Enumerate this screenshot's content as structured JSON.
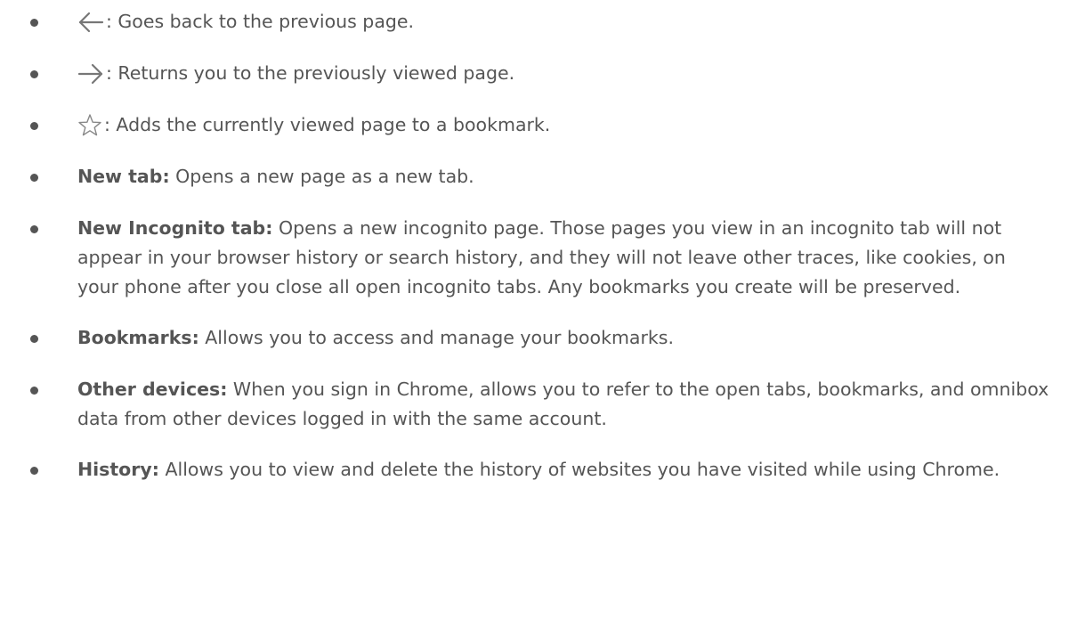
{
  "items": [
    {
      "icon": "back-arrow-icon",
      "desc": ": Goes back to the previous page."
    },
    {
      "icon": "forward-arrow-icon",
      "desc": ": Returns you to the previously viewed page."
    },
    {
      "icon": "star-outline-icon",
      "desc": ": Adds the currently viewed page to a bookmark."
    },
    {
      "term": "New tab:",
      "desc": " Opens a new page as a new tab."
    },
    {
      "term": "New Incognito tab:",
      "desc": " Opens a new incognito page. Those pages you view in an incognito tab will not appear in your browser history or search history, and they will not leave other traces, like cookies, on your phone after you close all open incognito tabs. Any bookmarks you create will be preserved."
    },
    {
      "term": "Bookmarks:",
      "desc": " Allows you to access and manage your bookmarks."
    },
    {
      "term": "Other devices:",
      "desc": " When you sign in Chrome, allows you to refer to the open tabs, bookmarks, and omnibox data from other devices logged in with the same account."
    },
    {
      "term": "History:",
      "desc": " Allows you to view and delete the history of websites you have visited while using Chrome."
    }
  ]
}
